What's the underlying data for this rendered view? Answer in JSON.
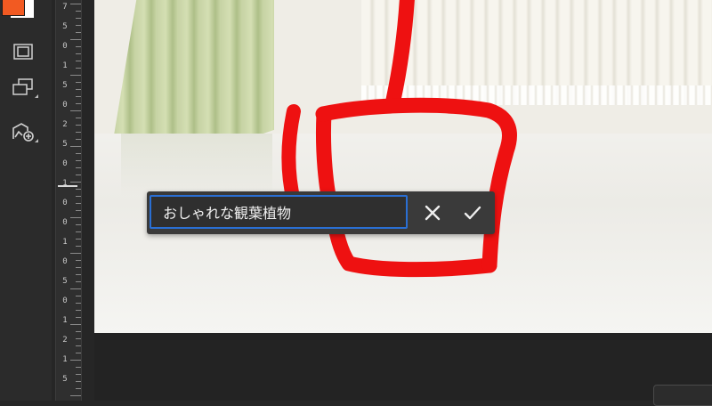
{
  "app": {
    "colors": {
      "foreground_swatch": "#f25a22",
      "background_swatch": "#ffffff",
      "accent": "#2a6fd4",
      "sketch_stroke": "#ee1111"
    }
  },
  "toolbar": {
    "tools": [
      {
        "name": "screen-mode-icon"
      },
      {
        "name": "artboard-icon"
      },
      {
        "name": "image-add-icon"
      }
    ]
  },
  "ruler": {
    "labels": [
      "7",
      "5",
      "0",
      "1",
      "5",
      "0",
      "2",
      "5",
      "0",
      "1",
      "0",
      "0",
      "1",
      "0",
      "5",
      "0",
      "1",
      "2",
      "1",
      "5"
    ]
  },
  "dialog": {
    "input_value": "おしゃれな観葉植物",
    "cancel_icon": "close-icon",
    "confirm_icon": "checkmark-icon"
  }
}
